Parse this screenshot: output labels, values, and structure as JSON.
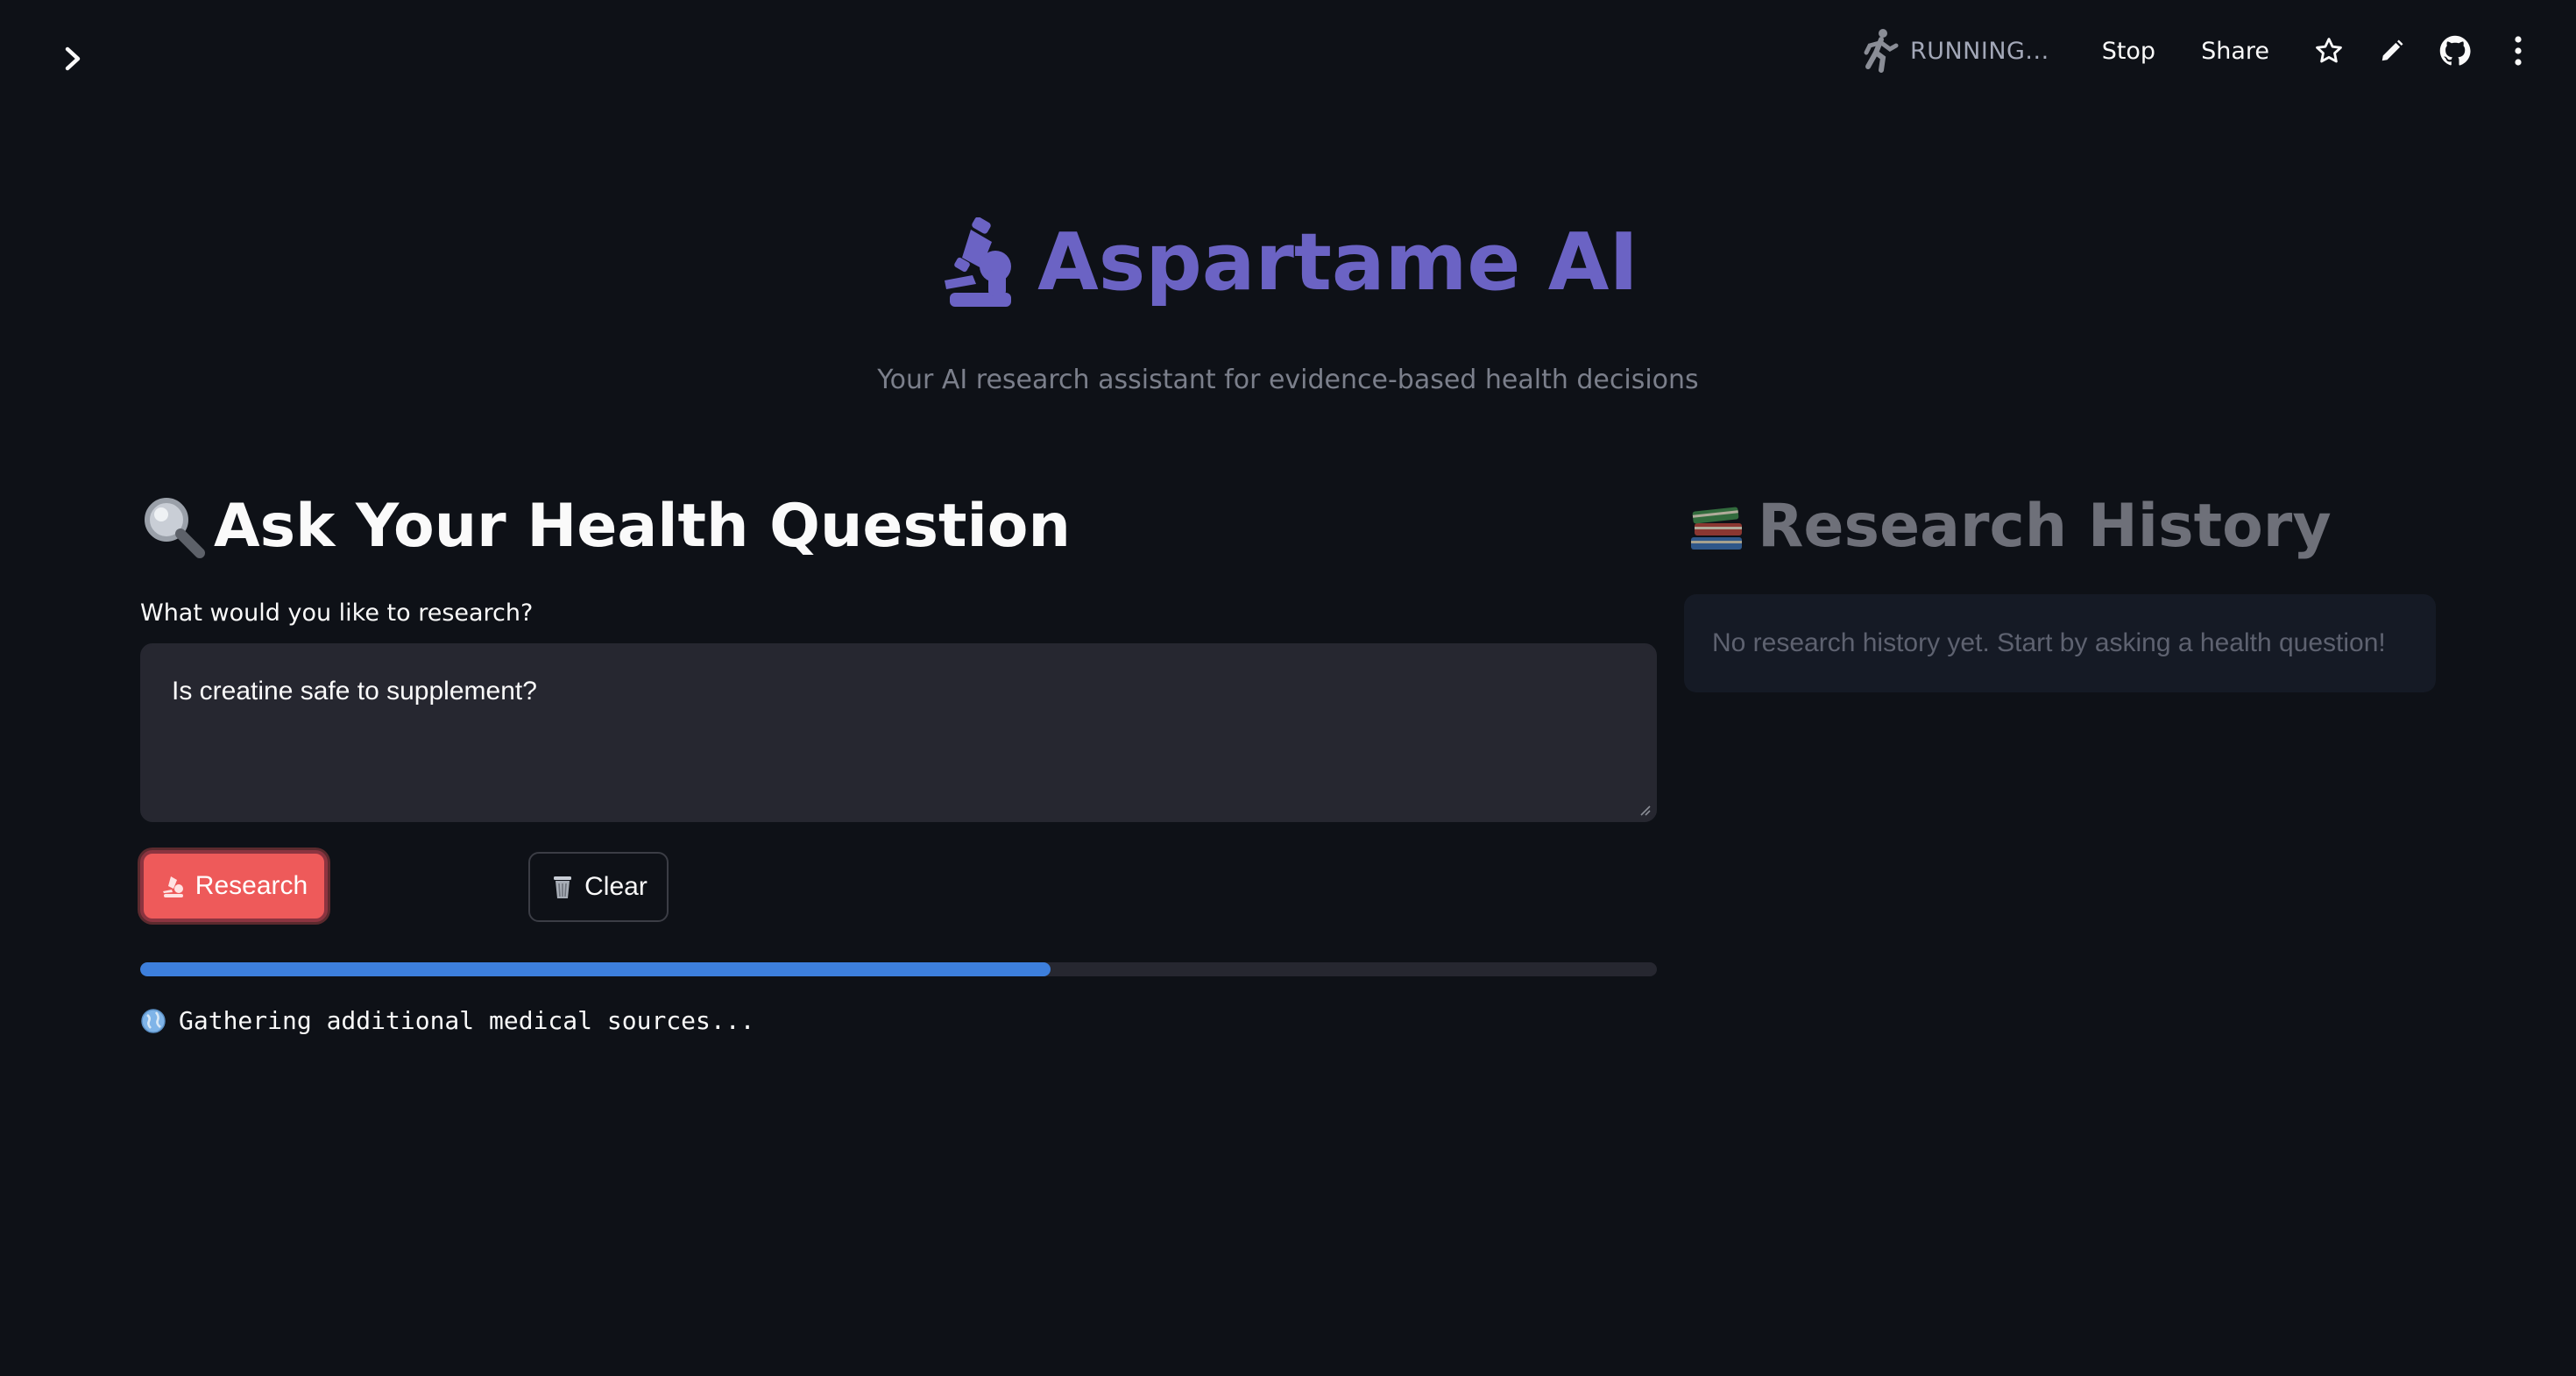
{
  "toolbar": {
    "status": "RUNNING...",
    "stop_label": "Stop",
    "share_label": "Share",
    "icons": [
      "running-figure-icon",
      "star-icon",
      "pencil-icon",
      "github-icon",
      "kebab-menu-icon"
    ]
  },
  "header": {
    "title": "Aspartame AI",
    "subtitle": "Your AI research assistant for evidence-based health decisions",
    "title_color": "#6b63c4"
  },
  "ask": {
    "heading": "Ask Your Health Question",
    "field_label": "What would you like to research?",
    "question_value": "Is creatine safe to supplement?",
    "research_label": "Research",
    "clear_label": "Clear",
    "progress_percent": 60,
    "status_message": "Gathering additional medical sources..."
  },
  "history": {
    "heading": "Research History",
    "empty_message": "No research history yet. Start by asking a health question!"
  },
  "colors": {
    "background": "#0e1117",
    "primary_button": "#ee5a5a",
    "progress": "#3d7fdc",
    "input_bg": "#262730"
  }
}
